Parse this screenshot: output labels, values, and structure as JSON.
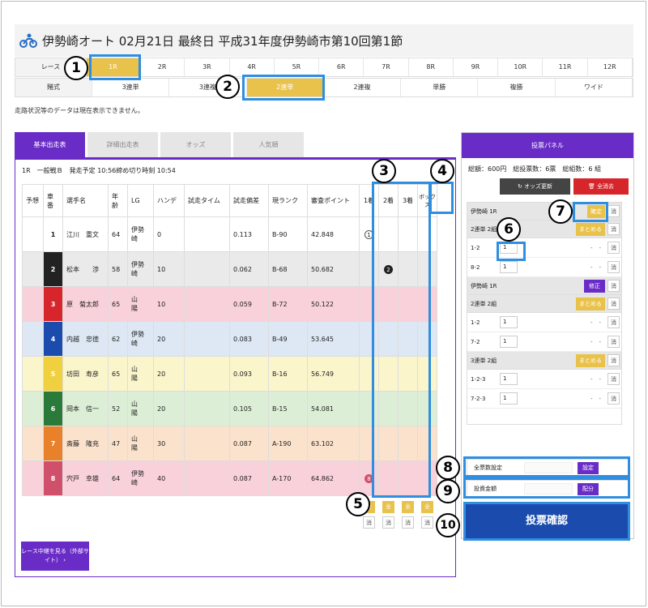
{
  "header": {
    "title": "伊勢崎オート 02月21日 最終日 平成31年度伊勢崎市第10回第1節"
  },
  "race_row": {
    "label": "レース",
    "races": [
      "1R",
      "2R",
      "3R",
      "4R",
      "5R",
      "6R",
      "7R",
      "8R",
      "9R",
      "10R",
      "11R",
      "12R"
    ]
  },
  "bet_row": {
    "label": "賭式",
    "types": [
      "3連単",
      "3連複",
      "2連単",
      "2連複",
      "単勝",
      "複勝",
      "ワイド"
    ]
  },
  "note": "走路状況等のデータは現在表示できません。",
  "tabs": [
    "基本出走表",
    "詳細出走表",
    "オッズ",
    "人気順"
  ],
  "race_info": "1R　一般戦Ｂ　発走予定 10:56締め切り時刻 10:54",
  "table": {
    "headers": [
      "予想",
      "車番",
      "選手名",
      "年齢",
      "LG",
      "ハンデ",
      "試走タイム",
      "試走偏差",
      "現ランク",
      "審査ポイント",
      "1着",
      "2着",
      "3着",
      "ボックス"
    ],
    "rows": [
      {
        "no": "1",
        "name": "江川　重文",
        "age": "64",
        "lg": "伊勢崎",
        "hande": "0",
        "dev": "0.113",
        "rank": "B-90",
        "point": "42.848",
        "color": "#ffffff",
        "fg": "#222",
        "mark1": "1"
      },
      {
        "no": "2",
        "name": "松本　　渉",
        "age": "58",
        "lg": "伊勢崎",
        "hande": "10",
        "dev": "0.062",
        "rank": "B-68",
        "point": "50.682",
        "color": "#222222",
        "fg": "#fff",
        "mark2": "2"
      },
      {
        "no": "3",
        "name": "原　菊太郎",
        "age": "65",
        "lg": "山　陽",
        "hande": "10",
        "dev": "0.059",
        "rank": "B-72",
        "point": "50.122",
        "color": "#d7262b",
        "fg": "#fff"
      },
      {
        "no": "4",
        "name": "内越　忠徳",
        "age": "62",
        "lg": "伊勢崎",
        "hande": "20",
        "dev": "0.083",
        "rank": "B-49",
        "point": "53.645",
        "color": "#1b4cad",
        "fg": "#fff"
      },
      {
        "no": "5",
        "name": "坊田　寿彦",
        "age": "65",
        "lg": "山　陽",
        "hande": "20",
        "dev": "0.093",
        "rank": "B-16",
        "point": "56.749",
        "color": "#f1d03f",
        "fg": "#fff"
      },
      {
        "no": "6",
        "name": "岡本　信一",
        "age": "52",
        "lg": "山　陽",
        "hande": "20",
        "dev": "0.105",
        "rank": "B-15",
        "point": "54.081",
        "color": "#2a7a3a",
        "fg": "#fff"
      },
      {
        "no": "7",
        "name": "斎藤　隆充",
        "age": "47",
        "lg": "山　陽",
        "hande": "30",
        "dev": "0.087",
        "rank": "A-190",
        "point": "63.102",
        "color": "#e9812a",
        "fg": "#fff"
      },
      {
        "no": "8",
        "name": "宍戸　幸雄",
        "age": "64",
        "lg": "伊勢崎",
        "hande": "40",
        "dev": "0.087",
        "rank": "A-170",
        "point": "64.862",
        "color": "#d0506b",
        "fg": "#fff",
        "mark1": "8"
      }
    ],
    "all_label": "全",
    "clear_label": "消"
  },
  "live_button": "レース中継を見る（外部サイト）",
  "panel": {
    "title": "投票パネル",
    "totals": "総額：600円　総投票数：6票　総組数：6 組",
    "odds_update": "オッズ更新",
    "clear_all": "全消去",
    "groups": [
      {
        "title": "伊勢崎 1R",
        "button": "確定",
        "btype": "y"
      },
      {
        "title": "2連単 2組",
        "button": "まとめる",
        "btype": "y",
        "lines": [
          {
            "combo": "1-2",
            "qty": "1"
          },
          {
            "combo": "8-2",
            "qty": "1"
          }
        ]
      },
      {
        "title": "伊勢崎 1R",
        "button": "修正",
        "btype": "p"
      },
      {
        "title": "2連単 2組",
        "button": "まとめる",
        "btype": "y",
        "lines": [
          {
            "combo": "1-2",
            "qty": "1"
          },
          {
            "combo": "7-2",
            "qty": "1"
          }
        ]
      },
      {
        "title": "3連単 2組",
        "button": "まとめる",
        "btype": "y",
        "lines": [
          {
            "combo": "1-2-3",
            "qty": "1"
          },
          {
            "combo": "7-2-3",
            "qty": "1"
          }
        ]
      }
    ],
    "dash": "-",
    "x_label": "消",
    "all_tickets": "全票数設定",
    "set_btn": "設定",
    "amount": "投資金額",
    "dist_btn": "配分",
    "confirm": "投票確認"
  },
  "badges": [
    "1",
    "2",
    "3",
    "4",
    "5",
    "6",
    "7",
    "8",
    "9",
    "10"
  ]
}
